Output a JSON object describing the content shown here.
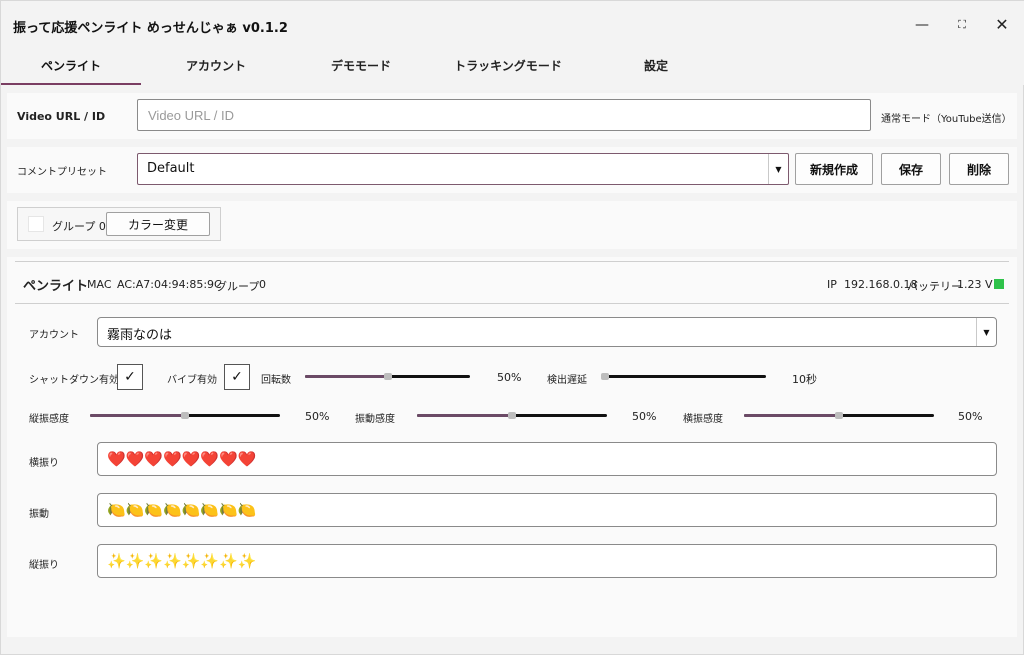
{
  "window": {
    "title": "振って応援ペンライト めっせんじゃぁ v0.1.2",
    "controls": {
      "minimize": "—",
      "maximize": "⛶",
      "close": "✕"
    }
  },
  "tabs": [
    {
      "label": "ペンライト",
      "active": true
    },
    {
      "label": "アカウント",
      "active": false
    },
    {
      "label": "デモモード",
      "active": false
    },
    {
      "label": "トラッキングモード",
      "active": false
    },
    {
      "label": "設定",
      "active": false
    }
  ],
  "video": {
    "label": "Video URL / ID",
    "value": "",
    "placeholder": "Video URL / ID",
    "mode_text": "通常モード（YouTube送信）"
  },
  "comment_preset": {
    "label": "コメントプリセット",
    "selected": "Default",
    "new_button": "新規作成",
    "save_button": "保存",
    "delete_button": "削除"
  },
  "group": {
    "label": "グループ 0",
    "color_button": "カラー変更",
    "color": "#ffffff"
  },
  "penlight": {
    "title": "ペンライト",
    "mac_label": "MAC",
    "mac_value": "AC:A7:04:94:85:9C",
    "group_label": "グループ",
    "group_value": "0",
    "ip_label": "IP",
    "ip_value": "192.168.0.18",
    "battery_label": "バッテリー",
    "battery_value": "1.23 V",
    "battery_color": "#2ec24a",
    "account_label": "アカウント",
    "account_selected": "霧雨なのは",
    "shutdown_label": "シャットダウン有効",
    "shutdown_checked": true,
    "vibe_label": "バイブ有効",
    "vibe_checked": true,
    "rotation_label": "回転数",
    "rotation_value": 0.5,
    "rotation_text": "50%",
    "delay_label": "検出遅延",
    "delay_value": 0.0,
    "delay_text": "10秒",
    "vertical_sens_label": "縦振感度",
    "vertical_sens_value": 0.5,
    "vertical_sens_text": "50%",
    "vibration_sens_label": "振動感度",
    "vibration_sens_value": 0.5,
    "vibration_sens_text": "50%",
    "horizontal_sens_label": "横振感度",
    "horizontal_sens_value": 0.5,
    "horizontal_sens_text": "50%",
    "shake_rows": [
      {
        "label": "横振り",
        "emoji": "❤️❤️❤️❤️❤️❤️❤️❤️",
        "icon": "heart-icon"
      },
      {
        "label": "振動",
        "emoji": "🍋🍋🍋🍋🍋🍋🍋🍋",
        "icon": "lemon-icon"
      },
      {
        "label": "縦振り",
        "emoji": "✨✨✨✨✨✨✨✨",
        "icon": "sparkle-icon"
      }
    ]
  },
  "colors": {
    "accent": "#7a3d62",
    "slider_fill": "#6b4a66"
  }
}
